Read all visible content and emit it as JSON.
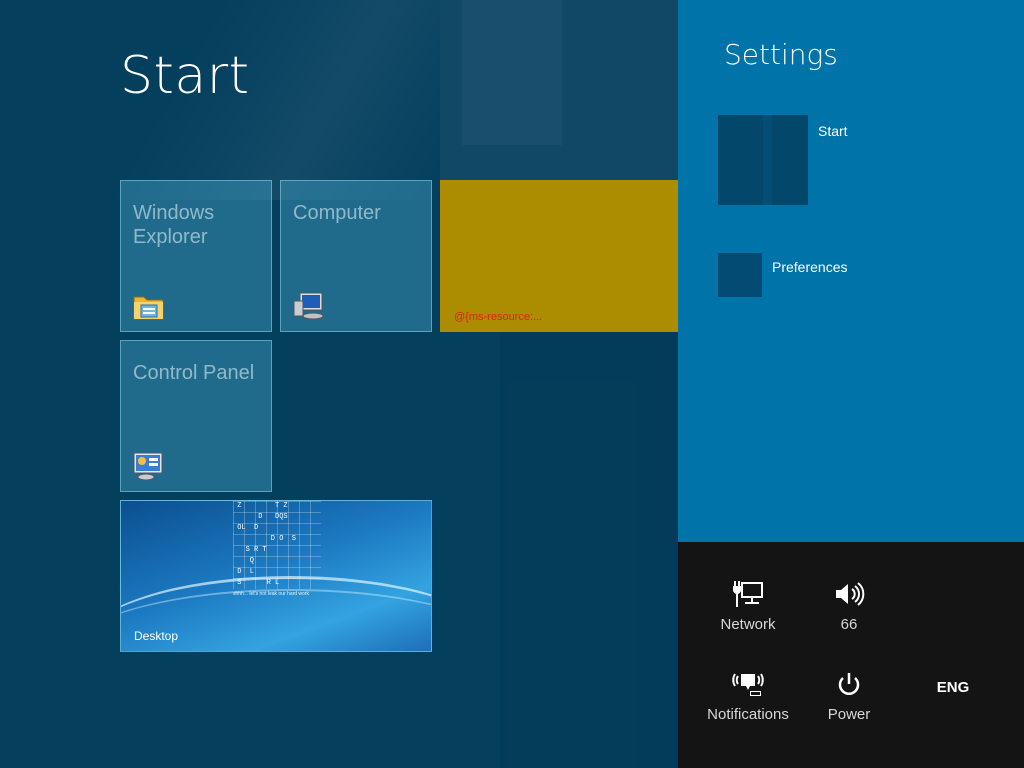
{
  "start_screen": {
    "title": "Start",
    "tiles": [
      {
        "label": "Windows Explorer",
        "icon": "folder-explorer-icon"
      },
      {
        "label": "Computer",
        "icon": "computer-icon"
      },
      {
        "label": "@{ms-resource:...",
        "color": "#ac8c00"
      },
      {
        "label": "Control Panel",
        "icon": "control-panel-icon"
      },
      {
        "label": "Desktop"
      }
    ],
    "desktop_wallpaper": {
      "grid_text": " Z        T Z\n      D   DQS\n OL  D      \n         D O  S\n   S R T\n    Q\n D  L\n S      R L",
      "tagline": "shhh... let's not leak our hard work"
    }
  },
  "settings": {
    "title": "Settings",
    "items": [
      {
        "label": "Start"
      },
      {
        "label": "Preferences"
      }
    ]
  },
  "tray": {
    "network": {
      "label": "Network",
      "icon": "network-icon"
    },
    "volume": {
      "label": "66",
      "icon": "speaker-icon"
    },
    "notifications": {
      "label": "Notifications",
      "icon": "notifications-icon"
    },
    "power": {
      "label": "Power",
      "icon": "power-icon"
    },
    "language": "ENG"
  },
  "colors": {
    "background": "#043f5e",
    "settings_panel": "#0073a8",
    "tray_panel": "#141414",
    "broken_tile": "#ac8c00"
  }
}
